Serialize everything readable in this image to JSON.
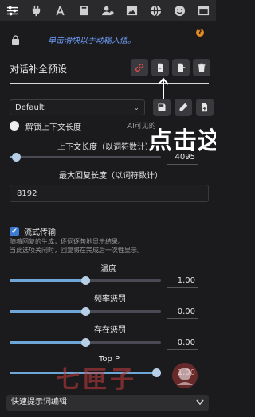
{
  "toolbar": {
    "icons": [
      "sliders-icon",
      "plug-icon",
      "font-icon",
      "book-icon",
      "users-gear-icon",
      "image-icon",
      "globe-icon",
      "smiley-icon",
      "window-icon"
    ]
  },
  "hint": {
    "text": "单击滑块以手动输入值。",
    "help": "?"
  },
  "completion_preset": {
    "title": "对话补全预设",
    "selected": "Default",
    "chevron": "⌄"
  },
  "unlock": {
    "label": "解锁上下文长度",
    "ai_hint": "AI可见的"
  },
  "overlay": {
    "text": "点击这"
  },
  "context_length": {
    "label": "上下文长度（以词符数计）",
    "value": "4095",
    "fraction": 0.04
  },
  "max_response": {
    "label": "最大回复长度（以词符数计）",
    "value": "8192"
  },
  "streaming": {
    "label": "流式传输",
    "check": "✔",
    "desc_line1": "随着回复的生成，逐词逐句地显示结果。",
    "desc_line2": "当此选项关闭时，回复将在完成后一次性显示。"
  },
  "temperature": {
    "label": "温度",
    "value": "1.00",
    "fraction": 0.5
  },
  "frequency_penalty": {
    "label": "频率惩罚",
    "value": "0.00",
    "fraction": 0.5
  },
  "presence_penalty": {
    "label": "存在惩罚",
    "value": "0.00",
    "fraction": 0.5
  },
  "top_p": {
    "label": "Top P",
    "value": "1.00",
    "fraction": 1.0
  },
  "watermark": {
    "text": "七匣子"
  },
  "footer": {
    "label": "快速提示词编辑"
  },
  "colors": {
    "accent": "#6ea6d8",
    "link_icon": "#e24c4c",
    "help_badge": "#e58a1f",
    "hint_text": "#6fa0ff"
  }
}
